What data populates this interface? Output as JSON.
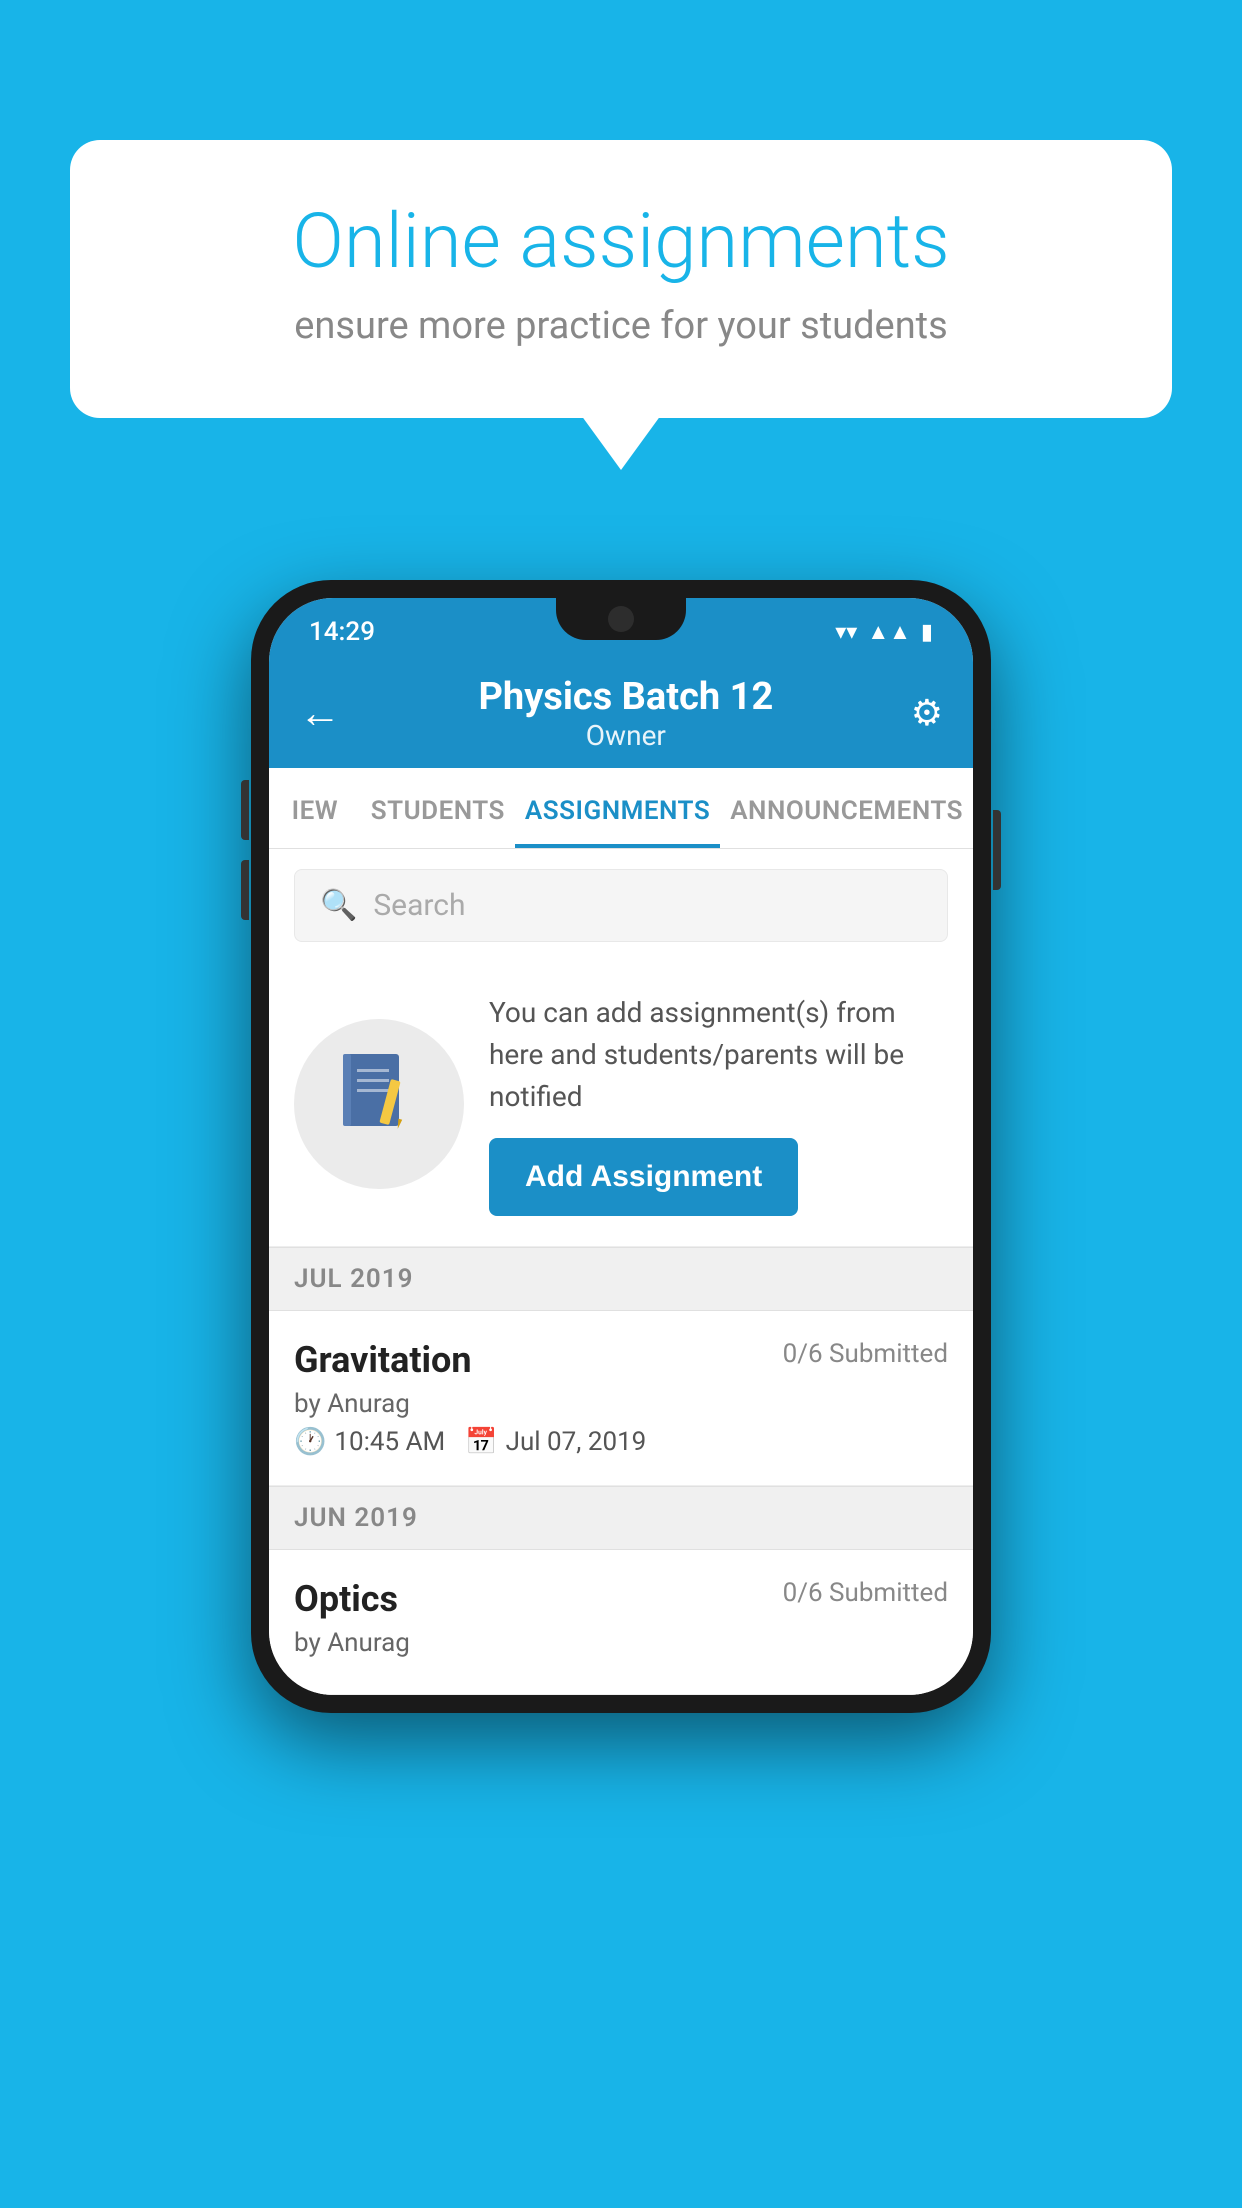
{
  "background": {
    "color": "#18b4e8"
  },
  "speech_bubble": {
    "title": "Online assignments",
    "subtitle": "ensure more practice for your students"
  },
  "status_bar": {
    "time": "14:29",
    "icons": [
      "wifi",
      "signal",
      "battery"
    ]
  },
  "app_bar": {
    "back_icon": "←",
    "title": "Physics Batch 12",
    "subtitle": "Owner",
    "settings_icon": "⚙"
  },
  "tabs": [
    {
      "label": "IEW",
      "active": false
    },
    {
      "label": "STUDENTS",
      "active": false
    },
    {
      "label": "ASSIGNMENTS",
      "active": true
    },
    {
      "label": "ANNOUNCEMENTS",
      "active": false
    }
  ],
  "search": {
    "placeholder": "Search"
  },
  "promo": {
    "text": "You can add assignment(s) from here and students/parents will be notified",
    "button_label": "Add Assignment"
  },
  "sections": [
    {
      "header": "JUL 2019",
      "assignments": [
        {
          "name": "Gravitation",
          "submitted": "0/6 Submitted",
          "by": "by Anurag",
          "time": "10:45 AM",
          "date": "Jul 07, 2019"
        }
      ]
    },
    {
      "header": "JUN 2019",
      "assignments": [
        {
          "name": "Optics",
          "submitted": "0/6 Submitted",
          "by": "by Anurag",
          "time": "",
          "date": ""
        }
      ]
    }
  ]
}
